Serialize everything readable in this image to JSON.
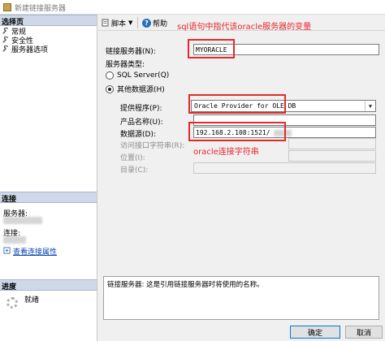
{
  "window": {
    "title": "新建链接服务器"
  },
  "left": {
    "select_page_header": "选择页",
    "pages": [
      {
        "label": "常规"
      },
      {
        "label": "安全性"
      },
      {
        "label": "服务器选项"
      }
    ],
    "connection_header": "连接",
    "server_label": "服务器:",
    "connection_label": "连接:",
    "view_connection_link": "查看连接属性",
    "progress_header": "进度",
    "progress_status": "就绪"
  },
  "toolbar": {
    "script_label": "脚本",
    "help_label": "帮助"
  },
  "annotations": {
    "top_note": "sql语句中指代该oracle服务器的变量",
    "datasource_note": "oracle连接字符串"
  },
  "form": {
    "linked_server_label": "链接服务器(N):",
    "linked_server_value": "MYORACLE",
    "server_type_label": "服务器类型:",
    "radio_sql_server": "SQL Server(Q)",
    "radio_other": "其他数据源(H)",
    "provider_label": "提供程序(P):",
    "provider_value": "Oracle Provider for OLE DB",
    "product_name_label": "产品名称(U):",
    "product_name_value": "",
    "data_source_label": "数据源(D):",
    "data_source_value": "192.168.2.108:1521/",
    "provider_string_label": "访问接口字符串(R):",
    "location_label": "位置(I):",
    "catalog_label": "目录(C):"
  },
  "description": "链接服务器: 这是引用链接服务器时将使用的名称。",
  "buttons": {
    "ok": "确定",
    "cancel": "取消"
  }
}
